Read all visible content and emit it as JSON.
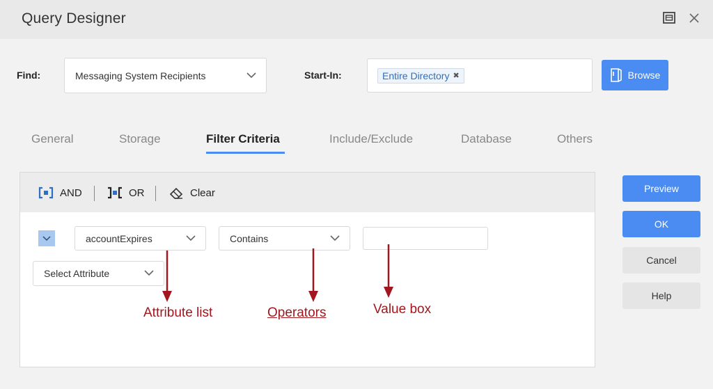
{
  "window": {
    "title": "Query Designer",
    "restore_icon": "restore-window-icon",
    "close_icon": "close-icon"
  },
  "find": {
    "label": "Find:",
    "value": "Messaging System Recipients"
  },
  "start_in": {
    "label": "Start-In:",
    "tag": "Entire Directory",
    "tag_remove": "✖"
  },
  "browse_label": "Browse",
  "tabs": [
    {
      "label": "General",
      "active": false
    },
    {
      "label": "Storage",
      "active": false
    },
    {
      "label": "Filter Criteria",
      "active": true
    },
    {
      "label": "Include/Exclude",
      "active": false
    },
    {
      "label": "Database",
      "active": false
    },
    {
      "label": "Others",
      "active": false
    }
  ],
  "toolbar": {
    "and_label": "AND",
    "or_label": "OR",
    "clear_label": "Clear"
  },
  "criteria": {
    "attribute": "accountExpires",
    "operator": "Contains",
    "value": "",
    "select_attribute_placeholder": "Select Attribute"
  },
  "annotations": {
    "attribute_list": "Attribute list",
    "operators": "Operators",
    "value_box": "Value box"
  },
  "actions": {
    "preview": "Preview",
    "ok": "OK",
    "cancel": "Cancel",
    "help": "Help"
  },
  "colors": {
    "accent": "#4a8cf2",
    "annotation": "#a3161d",
    "tag_text": "#2f6fc0"
  }
}
